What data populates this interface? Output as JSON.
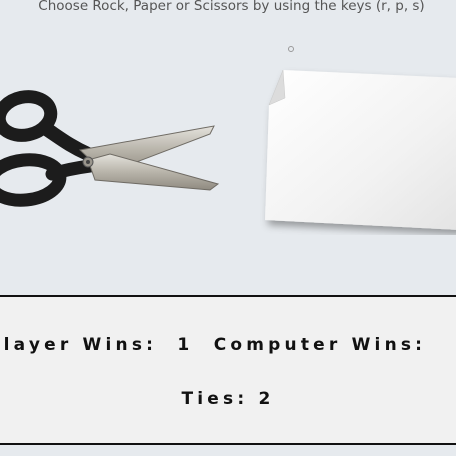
{
  "instructions": "Choose Rock, Paper or Scissors by using the keys (r, p, s)",
  "choices": {
    "player_choice": "scissors",
    "computer_choice": "paper"
  },
  "scores": {
    "player_label": "Player Wins:",
    "player_wins": "1",
    "computer_label": "Computer Wins:",
    "computer_wins": "",
    "ties_label": "Ties:",
    "ties": "2"
  }
}
